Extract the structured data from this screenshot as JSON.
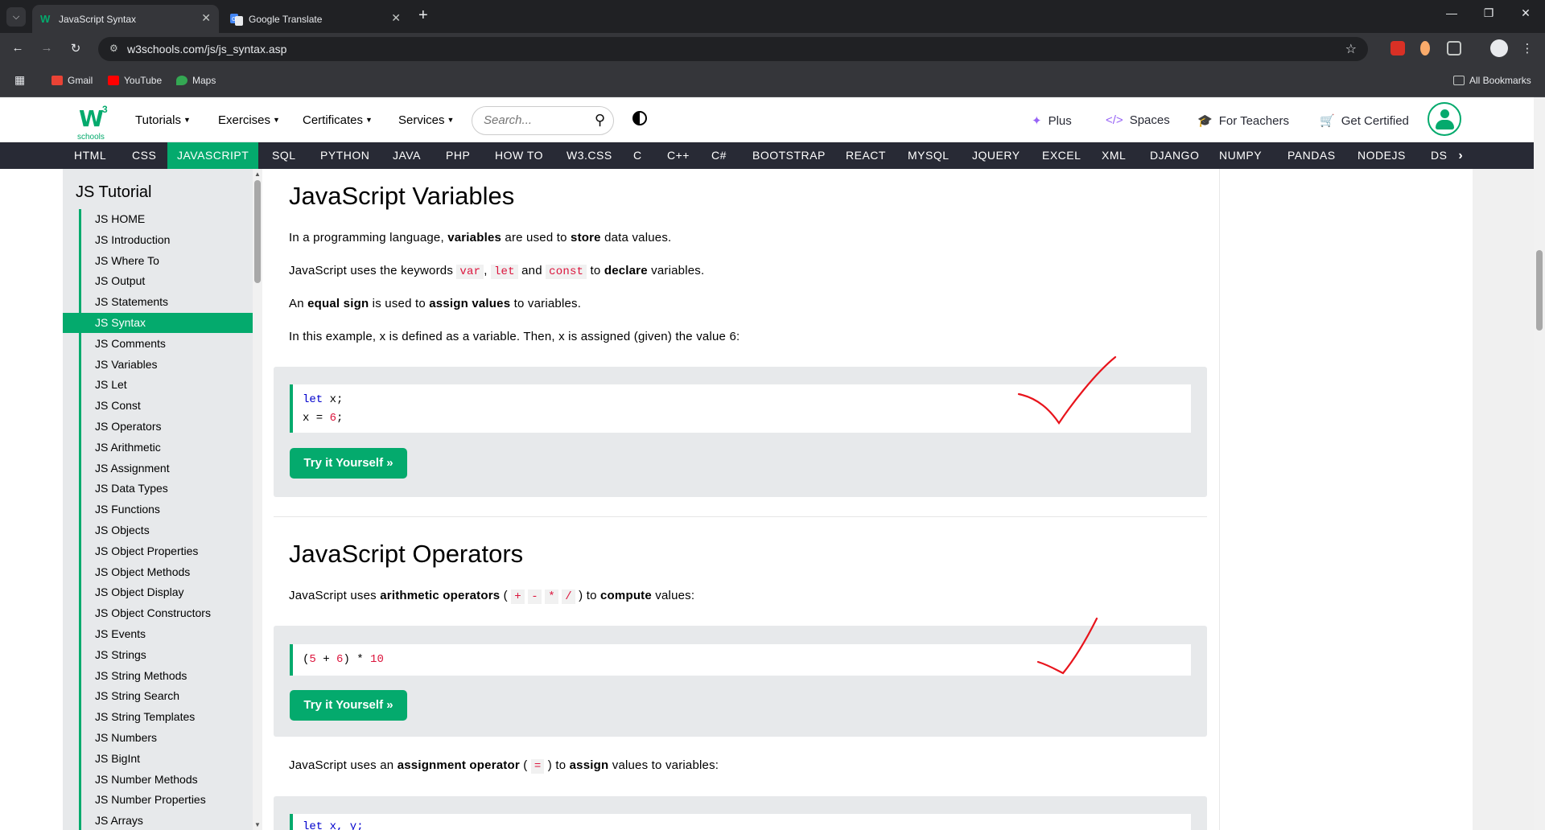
{
  "browser": {
    "tabs": [
      {
        "title": "JavaScript Syntax",
        "active": true
      },
      {
        "title": "Google Translate",
        "active": false
      }
    ],
    "url": "w3schools.com/js/js_syntax.asp",
    "bookmarks": [
      "Gmail",
      "YouTube",
      "Maps"
    ],
    "all_bookmarks": "All Bookmarks"
  },
  "w3nav": {
    "logo_sup": "3",
    "logo_text": "schools",
    "menus": [
      "Tutorials",
      "Exercises",
      "Certificates",
      "Services"
    ],
    "search_placeholder": "Search...",
    "right": [
      "Plus",
      "Spaces",
      "For Teachers",
      "Get Certified"
    ]
  },
  "subnav": [
    "HTML",
    "CSS",
    "JAVASCRIPT",
    "SQL",
    "PYTHON",
    "JAVA",
    "PHP",
    "HOW TO",
    "W3.CSS",
    "C",
    "C++",
    "C#",
    "BOOTSTRAP",
    "REACT",
    "MYSQL",
    "JQUERY",
    "EXCEL",
    "XML",
    "DJANGO",
    "NUMPY",
    "PANDAS",
    "NODEJS",
    "DS"
  ],
  "sidebar": {
    "title": "JS Tutorial",
    "items": [
      "JS HOME",
      "JS Introduction",
      "JS Where To",
      "JS Output",
      "JS Statements",
      "JS Syntax",
      "JS Comments",
      "JS Variables",
      "JS Let",
      "JS Const",
      "JS Operators",
      "JS Arithmetic",
      "JS Assignment",
      "JS Data Types",
      "JS Functions",
      "JS Objects",
      "JS Object Properties",
      "JS Object Methods",
      "JS Object Display",
      "JS Object Constructors",
      "JS Events",
      "JS Strings",
      "JS String Methods",
      "JS String Search",
      "JS String Templates",
      "JS Numbers",
      "JS BigInt",
      "JS Number Methods",
      "JS Number Properties",
      "JS Arrays"
    ],
    "active_index": 5
  },
  "content": {
    "variables": {
      "heading": "JavaScript Variables",
      "p1": {
        "a": "In a programming language, ",
        "b1": "variables",
        "c": " are used to ",
        "b2": "store",
        "d": " data values."
      },
      "p2": {
        "a": "JavaScript uses the keywords ",
        "k1": "var",
        "sep1": ",",
        "k2": "let",
        "and": "and",
        "k3": "const",
        "c": " to ",
        "b": "declare",
        "d": " variables."
      },
      "p3": {
        "a": "An ",
        "b1": "equal sign",
        "c": " is used to ",
        "b2": "assign values",
        "d": " to variables."
      },
      "p4": "In this example, x is defined as a variable. Then, x is assigned (given) the value 6:",
      "code_line1_kw": "let",
      "code_line1_rest": " x;",
      "code_line2_a": "x = ",
      "code_line2_num": "6",
      "code_line2_b": ";",
      "button": "Try it Yourself »"
    },
    "operators": {
      "heading": "JavaScript Operators",
      "p1": {
        "a": "JavaScript uses ",
        "b": "arithmetic operators",
        "c": " ( ",
        "ops": [
          "+",
          "-",
          "*",
          "/"
        ],
        "d": " ) to ",
        "b2": "compute",
        "e": " values:"
      },
      "code_a": "(",
      "code_n1": "5",
      "code_b": " + ",
      "code_n2": "6",
      "code_c": ") * ",
      "code_n3": "10",
      "button": "Try it Yourself »",
      "p2": {
        "a": "JavaScript uses an ",
        "b": "assignment operator",
        "c": " ( ",
        "op": "=",
        "d": " ) to ",
        "b2": "assign",
        "e": " values to variables:"
      },
      "code3_partial": "let x, y;"
    }
  },
  "colors": {
    "accent": "#04AA6D",
    "nav_dark": "#282A35",
    "annotation": "#e8141c"
  }
}
